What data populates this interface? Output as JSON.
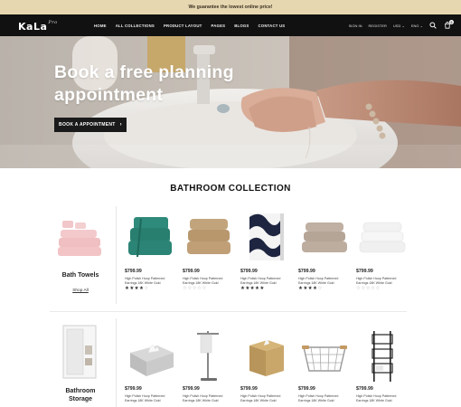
{
  "promo": {
    "text": "We guarantee the lowest online price!"
  },
  "header": {
    "logo": "KaLa",
    "logo_sub": "Pro",
    "menu": [
      "HOME",
      "ALL COLLECTIONS",
      "PRODUCT LAYOUT",
      "PAGES",
      "BLOGS",
      "CONTACT US"
    ],
    "utils": [
      "SIGN IN",
      "REGISTER",
      "USD",
      "ENG"
    ],
    "cart_count": "0"
  },
  "hero": {
    "title": "Book a free planning appointment",
    "button": "BOOK A APPOINTMENT"
  },
  "section": {
    "title": "BATHROOM COLLECTION"
  },
  "categories": [
    {
      "name": "Bath Towels",
      "link": "Shop All"
    },
    {
      "name": "Bathroom Storage"
    }
  ],
  "rows": [
    [
      {
        "price": "$799.99",
        "name": "High Polish Hoop Patterned Earrings 18K White Gold",
        "rating": 4,
        "image": "teal-towels"
      },
      {
        "price": "$799.99",
        "name": "High Polish Hoop Patterned Earrings 18K White Gold",
        "rating": 0,
        "image": "beige-towels"
      },
      {
        "price": "$799.99",
        "name": "High Polish Hoop Patterned Earrings 18K White Gold",
        "rating": 5,
        "image": "patterned-towel"
      },
      {
        "price": "$799.99",
        "name": "High Polish Hoop Patterned Earrings 18K White Gold",
        "rating": 4,
        "image": "taupe-towels"
      },
      {
        "price": "$799.99",
        "name": "High Polish Hoop Patterned Earrings 18K White Gold",
        "rating": 0,
        "image": "white-towels"
      }
    ],
    [
      {
        "price": "$799.99",
        "name": "High Polish Hoop Patterned Earrings 18K White Gold",
        "image": "tissue-box"
      },
      {
        "price": "$799.99",
        "name": "High Polish Hoop Patterned Earrings 18K White Gold",
        "image": "towel-stand"
      },
      {
        "price": "$799.99",
        "name": "High Polish Hoop Patterned Earrings 18K White Gold",
        "image": "gold-tissue-box"
      },
      {
        "price": "$799.99",
        "name": "High Polish Hoop Patterned Earrings 18K White Gold",
        "image": "wire-basket"
      },
      {
        "price": "$799.99",
        "name": "High Polish Hoop Patterned Earrings 18K White Gold",
        "image": "storage-tower"
      }
    ]
  ],
  "colors": {
    "promo_bg": "#e6d7b1",
    "nav_bg": "#111111",
    "button_bg": "#1a1a1a"
  }
}
